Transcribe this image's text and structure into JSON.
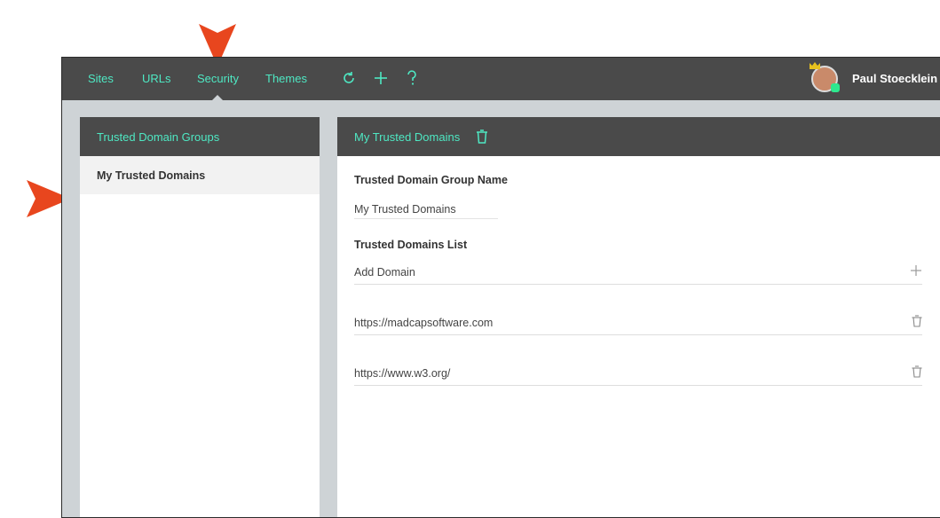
{
  "nav": {
    "items": [
      "Sites",
      "URLs",
      "Security",
      "Themes"
    ],
    "active": "Security",
    "tool_icons": [
      "refresh-icon",
      "plus-icon",
      "help-icon"
    ],
    "user_name": "Paul Stoecklein"
  },
  "left_panel": {
    "title": "Trusted Domain Groups",
    "groups": [
      "My Trusted Domains"
    ]
  },
  "right_panel": {
    "title": "My Trusted Domains",
    "group_name_label": "Trusted Domain Group Name",
    "group_name_value": "My Trusted Domains",
    "domains_list_label": "Trusted Domains List",
    "add_domain_label": "Add Domain",
    "domains": [
      "https://madcapsoftware.com",
      "https://www.w3.org/"
    ]
  },
  "colors": {
    "accent": "#4ee8c3",
    "topbar": "#4a4a4a",
    "background": "#ced3d6",
    "annotation_arrow": "#e8461e"
  }
}
